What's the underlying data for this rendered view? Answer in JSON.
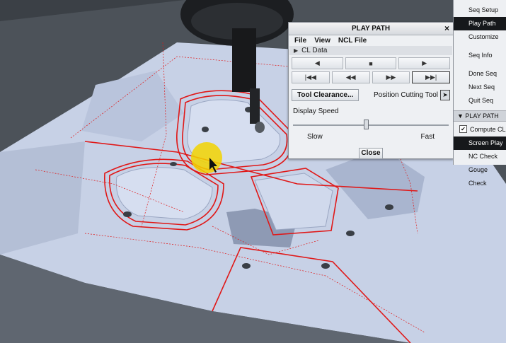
{
  "dialog": {
    "title": "PLAY PATH",
    "close_glyph": "×",
    "menus": [
      "File",
      "View",
      "NCL File"
    ],
    "cl_data_label": "CL Data",
    "controls_row1": [
      "play-backward-icon",
      "stop-icon",
      "play-forward-icon"
    ],
    "controls_row2": [
      "step-to-start-icon",
      "rewind-icon",
      "fast-forward-icon",
      "step-to-end-icon"
    ],
    "tool_clearance_label": "Tool Clearance...",
    "position_cutting_tool_label": "Position Cutting Tool",
    "display_speed_label": "Display Speed",
    "slider_level_percent": 47,
    "slow_label": "Slow",
    "fast_label": "Fast",
    "close_label": "Close"
  },
  "menu": {
    "items_top": [
      "Seq Setup",
      "Play Path",
      "Customize",
      "Seq Info",
      "Done Seq",
      "Next Seq",
      "Quit Seq"
    ],
    "active_item": "Play Path",
    "section_header": "PLAY PATH",
    "compute_cl_label": "Compute CL",
    "compute_cl_checked": true,
    "items_bottom": [
      "Screen Play",
      "NC Check",
      "Gouge Check"
    ],
    "active_bottom": "Screen Play"
  },
  "colors": {
    "toolpath": "#e01818",
    "part_surface": "#c9d3e8",
    "highlight": "#f2d400"
  }
}
